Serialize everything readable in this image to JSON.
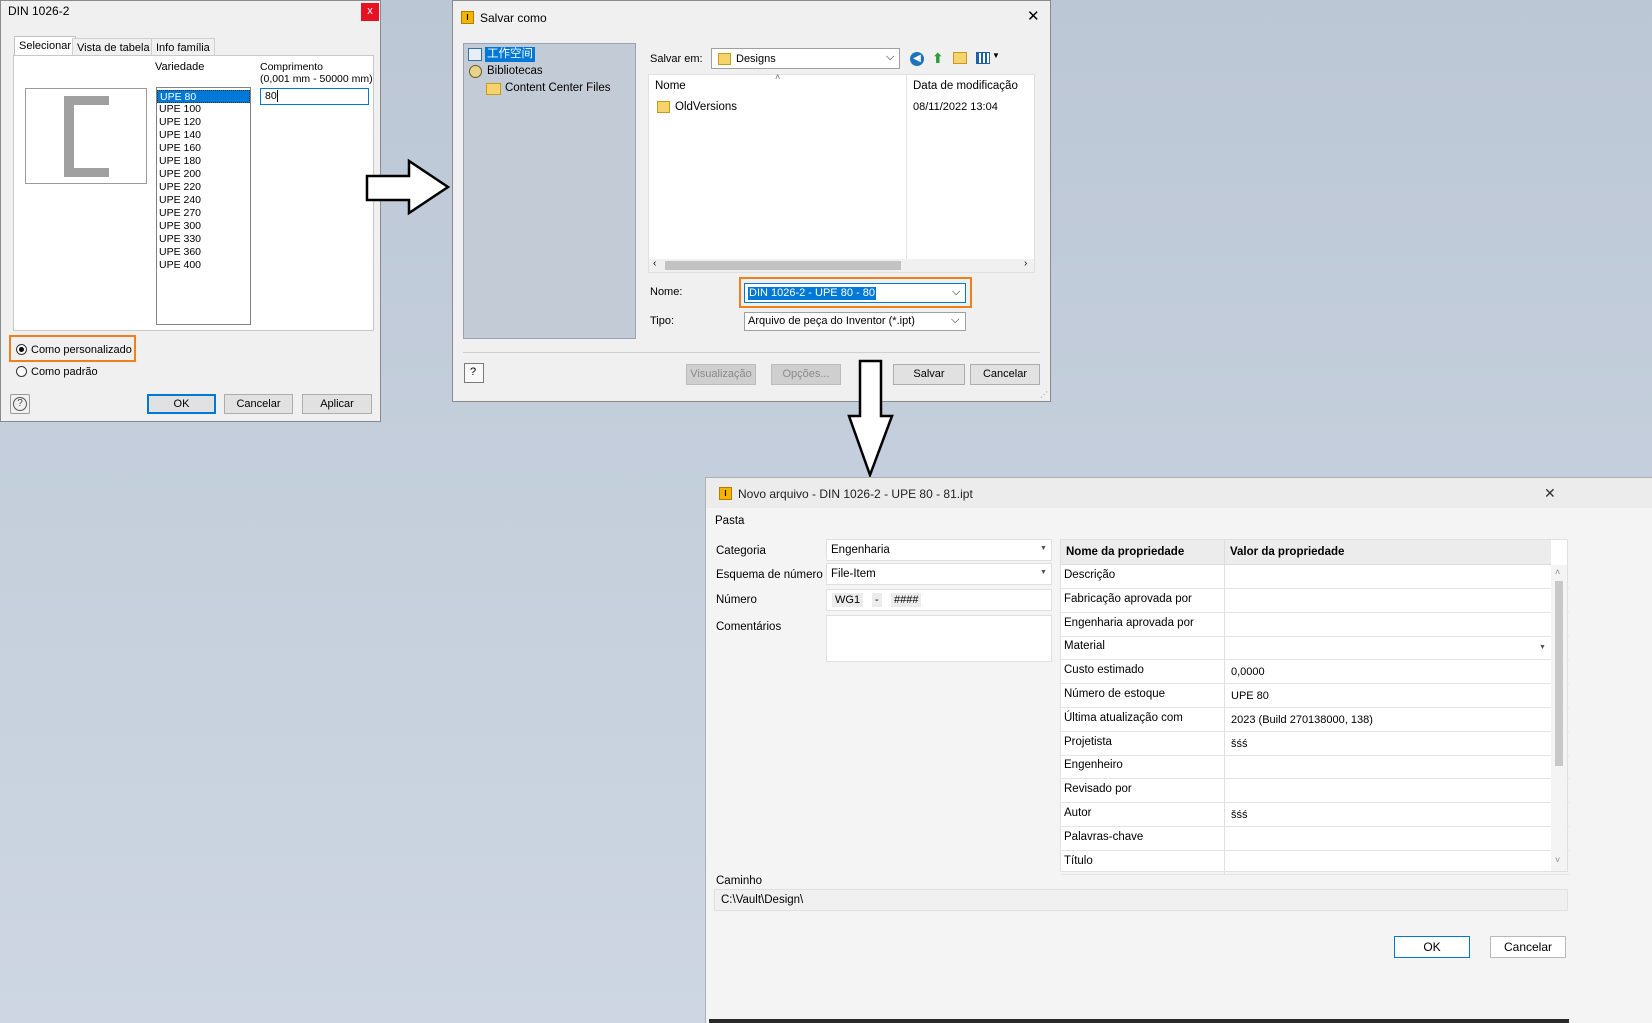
{
  "dialog1": {
    "title": "DIN 1026-2",
    "close_glyph": "x",
    "tabs": [
      "Selecionar",
      "Vista de tabela",
      "Info família"
    ],
    "variety_label": "Variedade",
    "length_label": "Comprimento",
    "length_range": "(0,001 mm - 50000 mm)",
    "length_value": "80",
    "varieties": [
      "UPE 80",
      "UPE 100",
      "UPE 120",
      "UPE 140",
      "UPE 160",
      "UPE 180",
      "UPE 200",
      "UPE 220",
      "UPE 240",
      "UPE 270",
      "UPE 300",
      "UPE 330",
      "UPE 360",
      "UPE 400"
    ],
    "radio_custom": "Como personalizado",
    "radio_standard": "Como padrão",
    "help_glyph": "?",
    "ok": "OK",
    "cancel": "Cancelar",
    "apply": "Aplicar"
  },
  "dialog2": {
    "title": "Salvar como",
    "close_glyph": "✕",
    "tree": [
      {
        "label": "工作空间",
        "icon": "workspace-icon",
        "selected": true
      },
      {
        "label": "Bibliotecas",
        "icon": "library-icon",
        "selected": false
      },
      {
        "label": "Content Center Files",
        "icon": "folder-icon",
        "selected": false
      }
    ],
    "save_in_label": "Salvar em:",
    "save_in_value": "Designs",
    "col_name": "Nome",
    "col_date": "Data de modificação",
    "files": [
      {
        "name": "OldVersions",
        "date": "08/11/2022 13:04"
      }
    ],
    "name_label": "Nome:",
    "name_value": "DIN 1026-2 - UPE 80 - 80",
    "type_label": "Tipo:",
    "type_value": "Arquivo de peça do Inventor (*.ipt)",
    "help_glyph": "?",
    "preview": "Visualização",
    "options": "Opções...",
    "save": "Salvar",
    "cancel": "Cancelar"
  },
  "dialog3": {
    "title": "Novo arquivo - DIN 1026-2 - UPE 80 - 81.ipt",
    "close_glyph": "✕",
    "folder_label": "Pasta",
    "category_label": "Categoria",
    "category_value": "Engenharia",
    "scheme_label": "Esquema de número",
    "scheme_value": "File-Item",
    "number_label": "Número",
    "number_parts": [
      "WG1",
      "-",
      "####"
    ],
    "comments_label": "Comentários",
    "prop_header_name": "Nome da propriedade",
    "prop_header_value": "Valor da propriedade",
    "properties": [
      {
        "name": "Descrição",
        "value": ""
      },
      {
        "name": "Fabricação aprovada por",
        "value": ""
      },
      {
        "name": "Engenharia aprovada por",
        "value": ""
      },
      {
        "name": "Material",
        "value": ""
      },
      {
        "name": "Custo estimado",
        "value": "0,0000"
      },
      {
        "name": "Número de estoque",
        "value": "UPE 80"
      },
      {
        "name": "Última atualização com",
        "value": "2023 (Build 270138000, 138)"
      },
      {
        "name": "Projetista",
        "value": "šśś"
      },
      {
        "name": "Engenheiro",
        "value": ""
      },
      {
        "name": "Revisado por",
        "value": ""
      },
      {
        "name": "Autor",
        "value": "šśś"
      },
      {
        "name": "Palavras-chave",
        "value": ""
      },
      {
        "name": "Título",
        "value": ""
      }
    ],
    "path_label": "Caminho",
    "path_value": "C:\\Vault\\Design\\",
    "ok": "OK",
    "cancel": "Cancelar"
  },
  "colors": {
    "accent": "#0078d7",
    "highlight": "#f0801e",
    "close_red": "#e81123"
  }
}
